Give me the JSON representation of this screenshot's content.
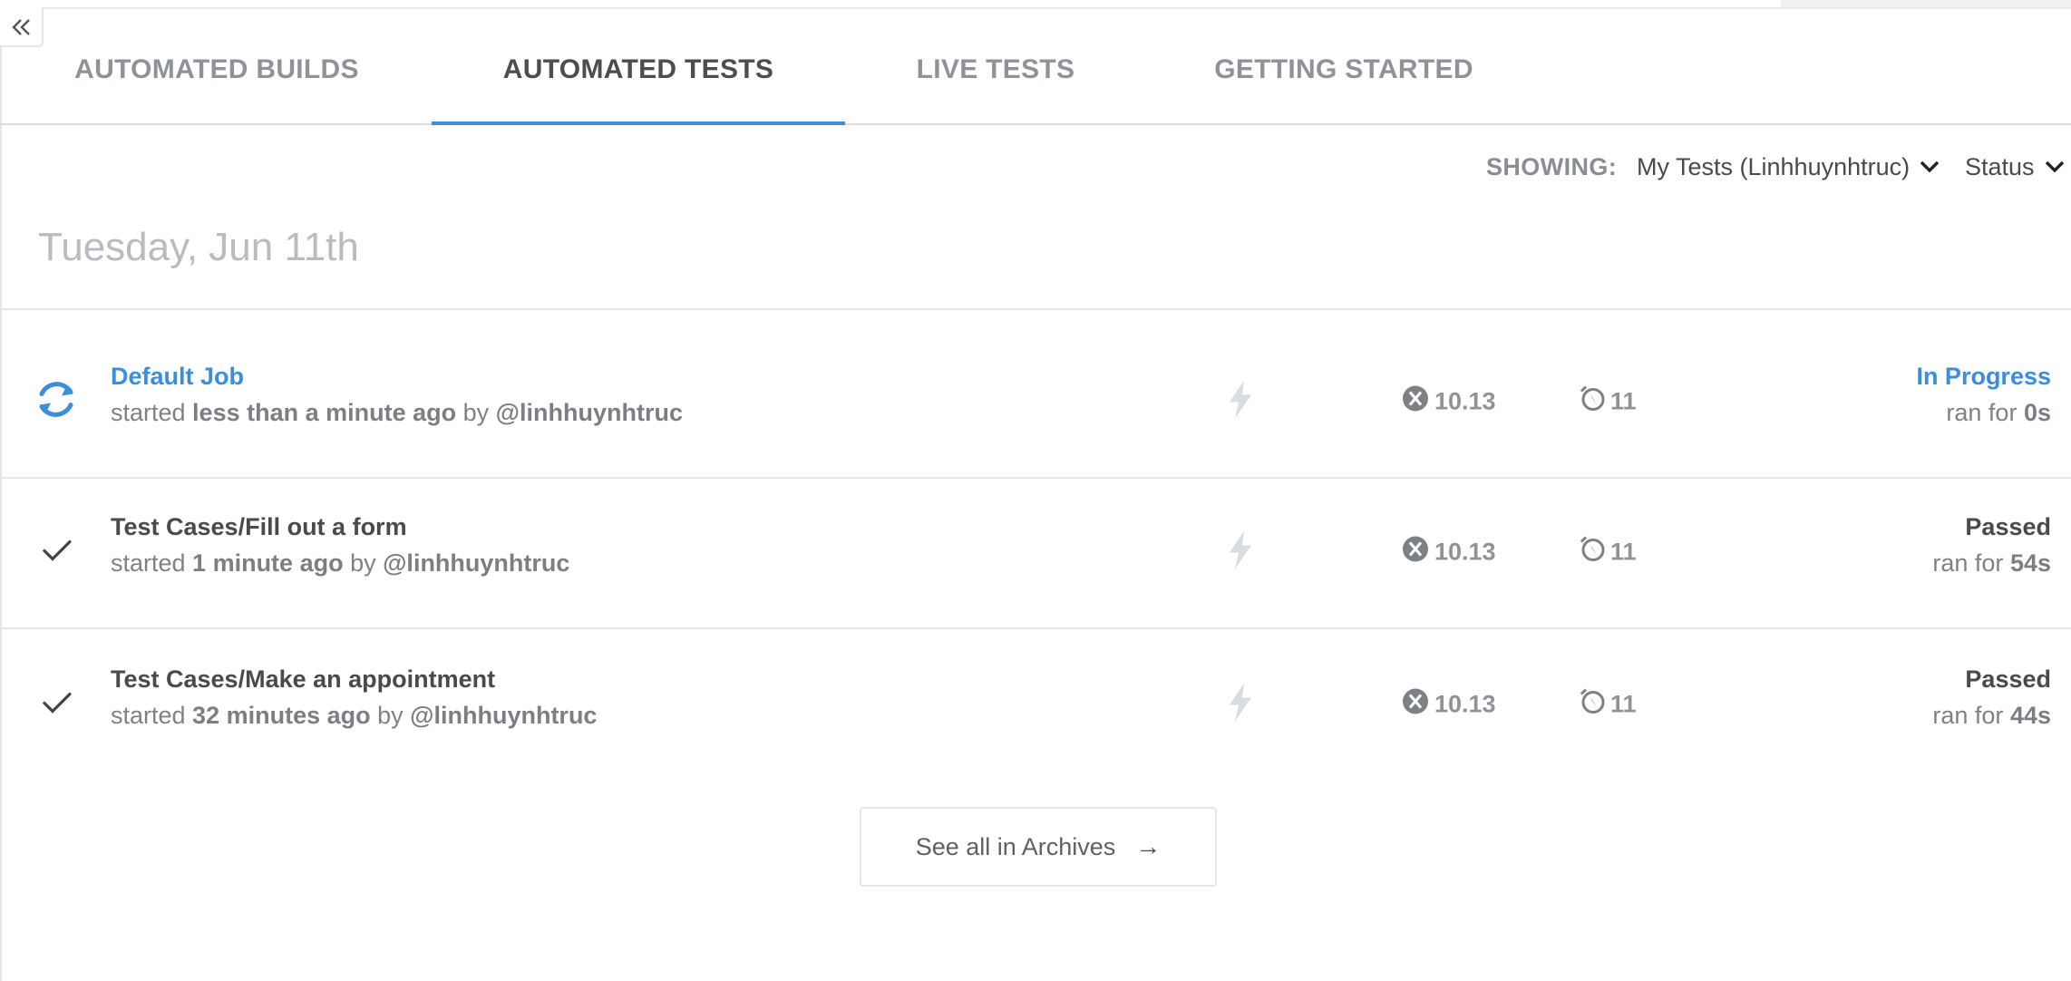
{
  "tabs": [
    {
      "label": "AUTOMATED BUILDS",
      "active": false
    },
    {
      "label": "AUTOMATED TESTS",
      "active": true
    },
    {
      "label": "LIVE TESTS",
      "active": false
    },
    {
      "label": "GETTING STARTED",
      "active": false
    }
  ],
  "filters": {
    "showing_label": "SHOWING:",
    "scope_value": "My Tests (Linhhuynhtruc)",
    "status_value": "Status"
  },
  "date_header": "Tuesday, Jun 11th",
  "jobs": [
    {
      "name": "Default Job",
      "started_prefix": "started ",
      "started_when": "less than a minute ago",
      "started_by_prefix": " by ",
      "user": "@linhhuynhtruc",
      "os_version": "10.13",
      "browser_version": "11",
      "result": "In Progress",
      "duration_prefix": "ran for ",
      "duration": "0s",
      "state_icon": "refresh-icon"
    },
    {
      "name": "Test Cases/Fill out a form",
      "started_prefix": "started ",
      "started_when": "1 minute ago",
      "started_by_prefix": " by ",
      "user": "@linhhuynhtruc",
      "os_version": "10.13",
      "browser_version": "11",
      "result": "Passed",
      "duration_prefix": "ran for ",
      "duration": "54s",
      "state_icon": "checkmark-icon"
    },
    {
      "name": "Test Cases/Make an appointment",
      "started_prefix": "started ",
      "started_when": "32 minutes ago",
      "started_by_prefix": " by ",
      "user": "@linhhuynhtruc",
      "os_version": "10.13",
      "browser_version": "11",
      "result": "Passed",
      "duration_prefix": "ran for ",
      "duration": "44s",
      "state_icon": "checkmark-icon"
    }
  ],
  "archives_button": {
    "label": "See all in Archives",
    "arrow": "→"
  },
  "colors": {
    "accent": "#3f8ede",
    "link": "#3b8ede",
    "muted_text": "#8f9399",
    "divider": "#e6e6e6"
  }
}
